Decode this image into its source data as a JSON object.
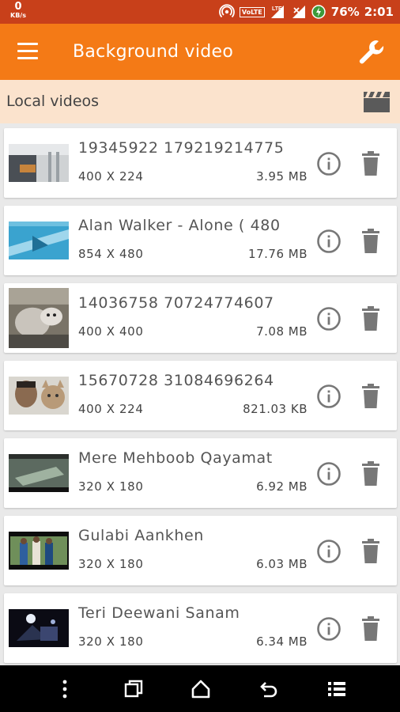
{
  "status_bar": {
    "net_speed": "0",
    "net_unit": "KB/s",
    "volte": "VoLTE",
    "lte": "LTE",
    "battery": "76%",
    "time": "2:01"
  },
  "toolbar": {
    "title": "Background video",
    "menu_icon": "hamburger-menu-icon",
    "settings_icon": "wrench-icon"
  },
  "section": {
    "label": "Local videos",
    "icon": "clapperboard-icon"
  },
  "videos": [
    {
      "name": "19345922  179219214775",
      "resolution": "400 X 224",
      "size": "3.95 MB"
    },
    {
      "name": "Alan Walker - Alone ( 480",
      "resolution": "854 X 480",
      "size": "17.76 MB"
    },
    {
      "name": "14036758  70724774607",
      "resolution": "400 X 400",
      "size": "7.08 MB"
    },
    {
      "name": "15670728  31084696264",
      "resolution": "400 X 224",
      "size": "821.03 KB"
    },
    {
      "name": "Mere Mehboob Qayamat",
      "resolution": "320 X 180",
      "size": "6.92 MB"
    },
    {
      "name": "Gulabi Aankhen",
      "resolution": "320 X 180",
      "size": "6.03 MB"
    },
    {
      "name": "Teri Deewani    Sanam",
      "resolution": "320 X 180",
      "size": "6.34 MB"
    }
  ],
  "colors": {
    "status_bar": "#c8401a",
    "toolbar": "#f47a16",
    "section_bg": "#fbe3cd",
    "icon_gray": "#777777"
  }
}
